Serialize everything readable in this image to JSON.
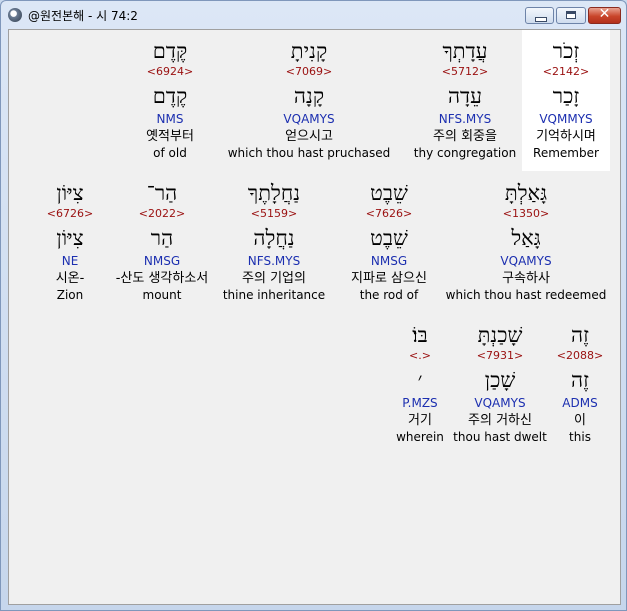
{
  "window": {
    "title": "@원전본해 - 시 74:2",
    "controls": {
      "minimize": "",
      "maximize": "",
      "close": "✕"
    }
  },
  "rows": [
    {
      "words": [
        {
          "hebrew": "זְכֹר",
          "strong": "<2142>",
          "lemma": "זָכַר",
          "morph": "VQMMYS",
          "korean": "기억하시며",
          "english": "Remember",
          "highlight": true
        },
        {
          "hebrew": "עֲדָתְךָ",
          "strong": "<5712>",
          "lemma": "עֵדָה",
          "morph": "NFS.MYS",
          "korean": "주의 회중을",
          "english": "thy congregation"
        },
        {
          "hebrew": "קָנִיתָ",
          "strong": "<7069>",
          "lemma": "קָנָה",
          "morph": "VQAMYS",
          "korean": "얻으시고",
          "english": "which thou hast pruchased"
        },
        {
          "hebrew": "קֶּדֶם",
          "strong": "<6924>",
          "lemma": "קֶדֶם",
          "morph": "NMS",
          "korean": "옛적부터",
          "english": "of old"
        }
      ]
    },
    {
      "words": [
        {
          "hebrew": "גָּאַלְתָּ",
          "strong": "<1350>",
          "lemma": "גָּאַל",
          "morph": "VQAMYS",
          "korean": "구속하사",
          "english": "which thou hast redeemed"
        },
        {
          "hebrew": "שֵׁבֶט",
          "strong": "<7626>",
          "lemma": "שֵׁבֶט",
          "morph": "NMSG",
          "korean": "지파로 삼으신",
          "english": "the rod of"
        },
        {
          "hebrew": "נַחֲלָתֶךָ",
          "strong": "<5159>",
          "lemma": "נַחֲלָה",
          "morph": "NFS.MYS",
          "korean": "주의 기업의",
          "english": "thine inheritance"
        },
        {
          "hebrew": "הַר־",
          "strong": "<2022>",
          "lemma": "הַר",
          "morph": "NMSG",
          "korean": "-산도 생각하소서",
          "english": "mount"
        },
        {
          "hebrew": "צִיּוֹן",
          "strong": "<6726>",
          "lemma": "צִיּוֹן",
          "morph": "NE",
          "korean": "시온-",
          "english": "Zion"
        }
      ]
    },
    {
      "words": [
        {
          "hebrew": "זֶה",
          "strong": "<2088>",
          "lemma": "זֶה",
          "morph": "ADMS",
          "korean": "이",
          "english": "this"
        },
        {
          "hebrew": "שָׁכַנְתָּ",
          "strong": "<7931>",
          "lemma": "שָׁכַן",
          "morph": "VQAMYS",
          "korean": "주의 거하신",
          "english": "thou hast dwelt"
        },
        {
          "hebrew": "בּוֹ׃",
          "strong": "<.>",
          "lemma": "׳",
          "morph": "P.MZS",
          "korean": "거기",
          "english": "wherein"
        }
      ]
    }
  ],
  "colors": {
    "strong": "#9a1010",
    "morph": "#1c2fb0",
    "background": "#f0f0f0",
    "highlight": "#ffffff"
  }
}
